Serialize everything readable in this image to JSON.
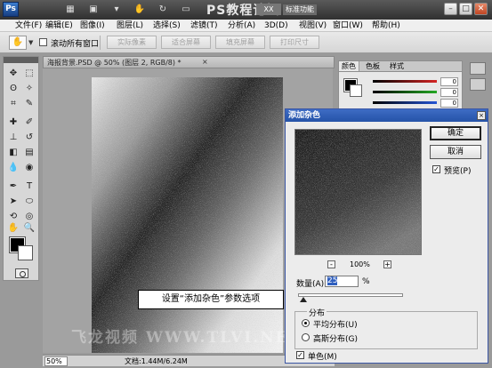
{
  "app": {
    "logo": "Ps",
    "title": "PS教程论坛",
    "title_tag": "标准功能",
    "zoom_box": "XX"
  },
  "window_controls": {
    "minimize": "–",
    "maximize": "□",
    "close": "✕"
  },
  "menu": [
    "文件(F)",
    "编辑(E)",
    "图像(I)",
    "图层(L)",
    "选择(S)",
    "滤镜(T)",
    "分析(A)",
    "3D(D)",
    "视图(V)",
    "窗口(W)",
    "帮助(H)"
  ],
  "options_bar": {
    "tool_icon": "hand-icon",
    "checkbox_label": "滚动所有窗口",
    "buttons": [
      "实际像素",
      "适合屏幕",
      "填充屏幕",
      "打印尺寸"
    ]
  },
  "document": {
    "tab_label": "海报背景.PSD @ 50% (图层 2, RGB/8) *",
    "tab_close": "×",
    "zoom": "50%",
    "file_info": "文档:1.44M/6.24M",
    "watermark": "飞龙视频 WWW.TLVI.NET"
  },
  "color_panel": {
    "tabs": [
      "颜色",
      "色板",
      "样式"
    ],
    "sliders": [
      {
        "channel": "R",
        "value": "0",
        "color": "#d42424"
      },
      {
        "channel": "G",
        "value": "0",
        "color": "#25a825"
      },
      {
        "channel": "B",
        "value": "0",
        "color": "#2454d4"
      }
    ]
  },
  "dialog": {
    "title": "添加杂色",
    "close": "×",
    "ok_label": "确定",
    "cancel_label": "取消",
    "preview_label": "预览(P)",
    "preview_checked": true,
    "zoom_minus": "-",
    "zoom_plus": "+",
    "zoom_value": "100%",
    "amount_label": "数量(A):",
    "amount_value": "25",
    "amount_unit": "%",
    "amount_level": 0.05,
    "distribution_title": "分布",
    "uniform_label": "平均分布(U)",
    "gaussian_label": "高斯分布(G)",
    "uniform_selected": true,
    "mono_label": "单色(M)",
    "mono_checked": true
  },
  "callout": {
    "text": "设置“添加杂色”参数选项"
  }
}
